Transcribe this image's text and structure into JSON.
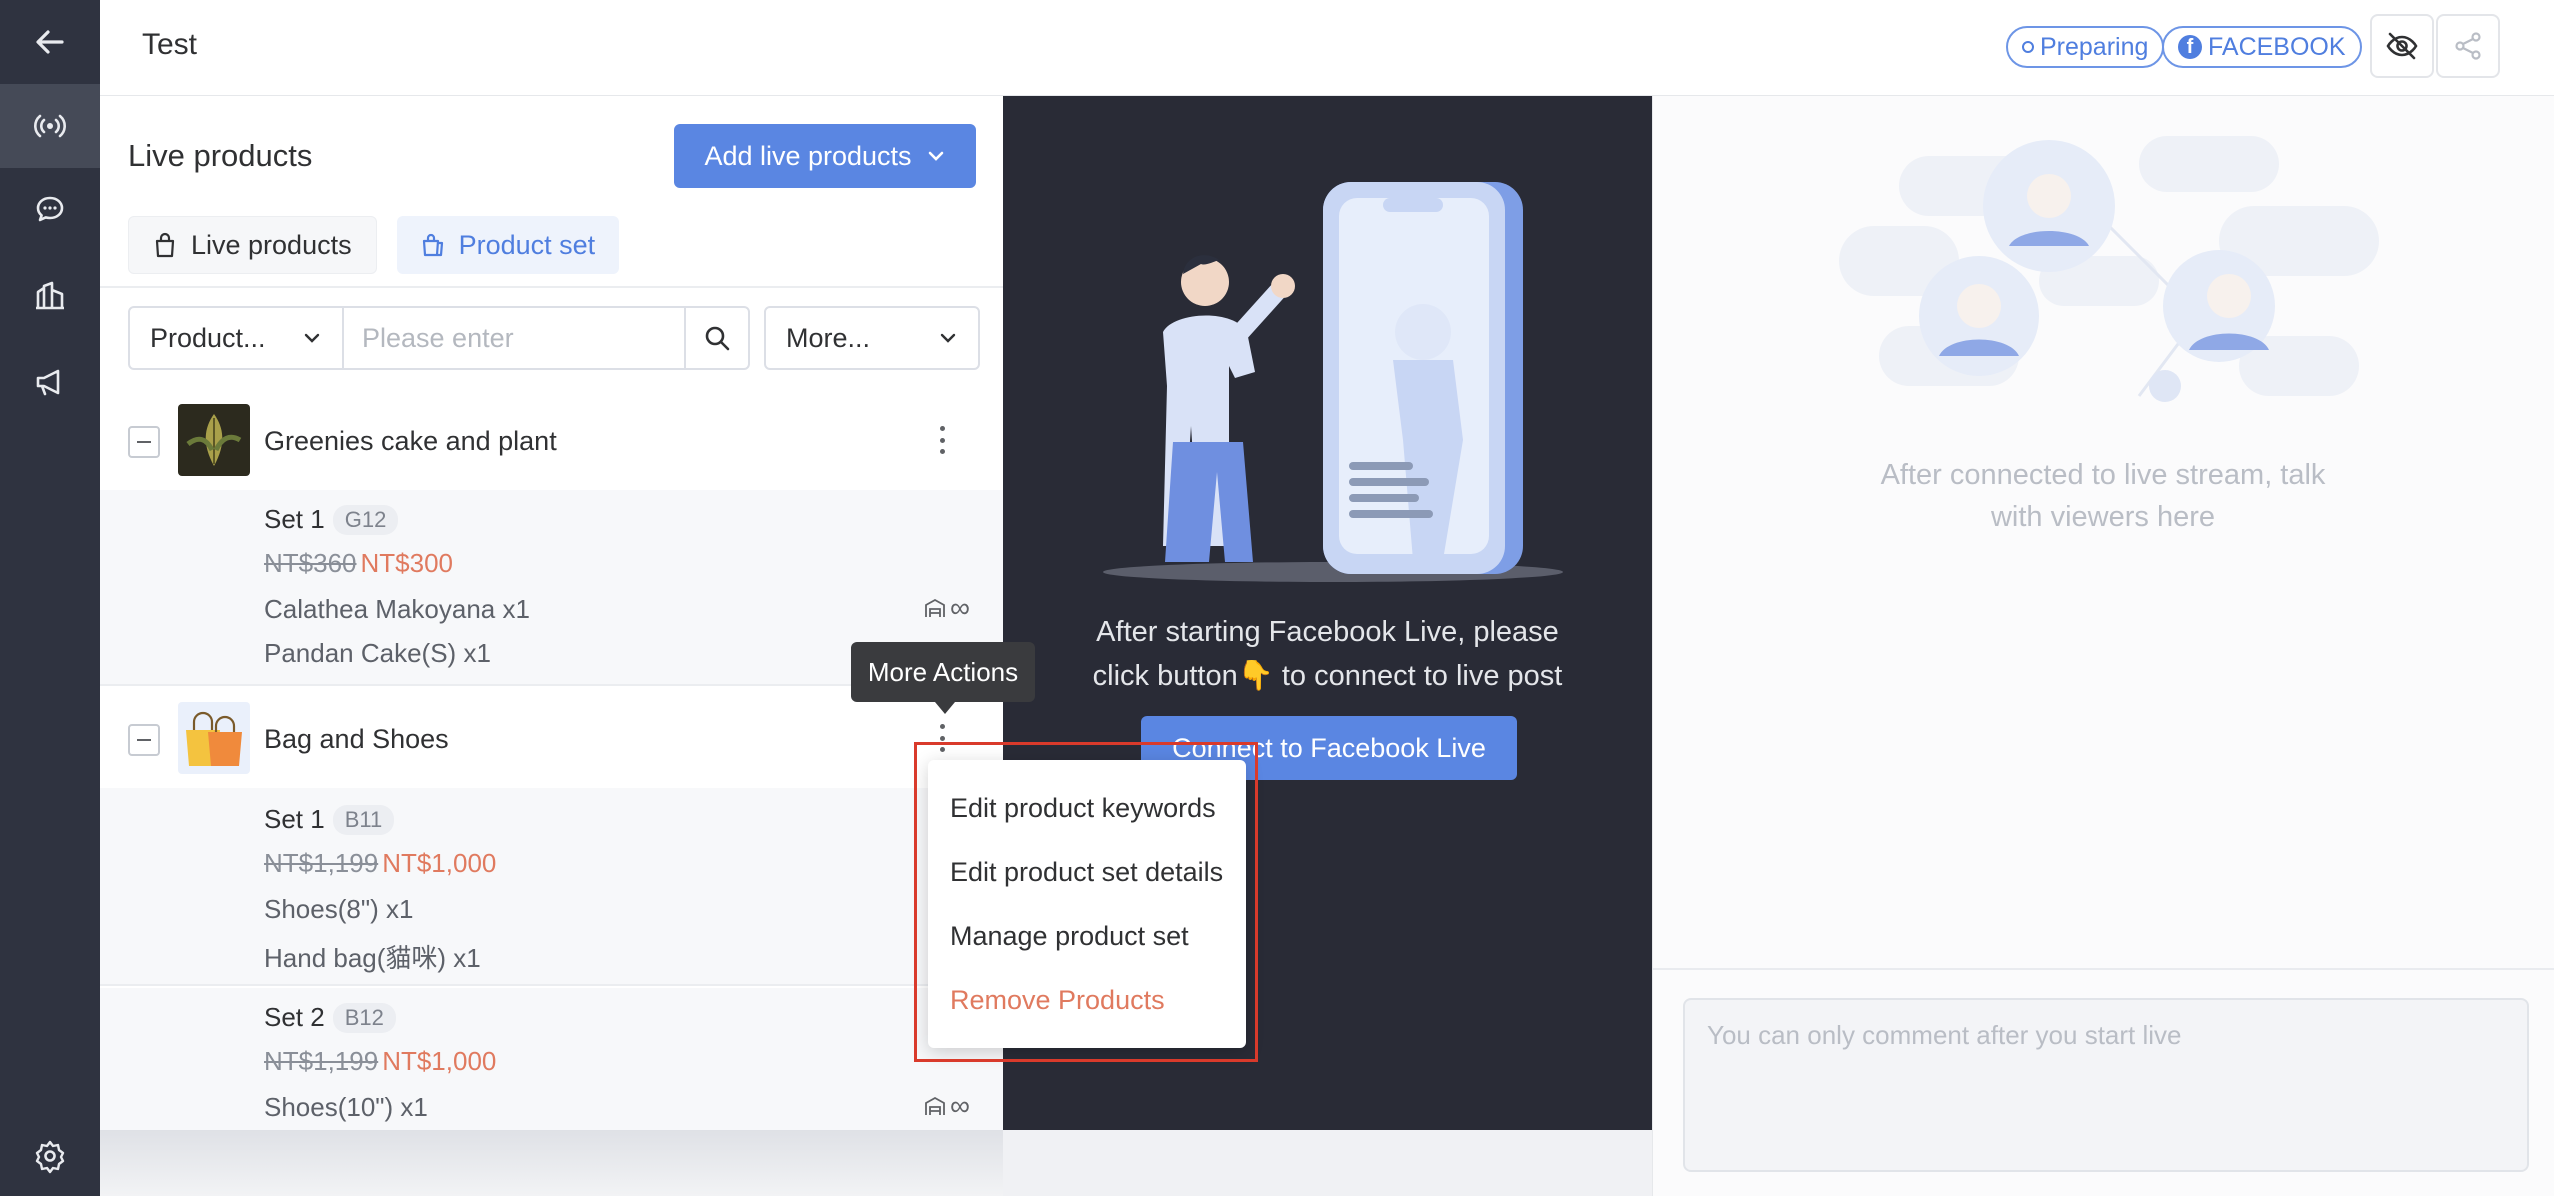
{
  "topbar": {
    "title": "Test",
    "status_badge": "Preparing",
    "platform_badge": "FACEBOOK"
  },
  "rail": {
    "icons": [
      "back-arrow-icon",
      "broadcast-icon",
      "chat-icon",
      "store-icon",
      "megaphone-icon",
      "settings-gear-icon"
    ],
    "active": "broadcast-icon"
  },
  "panel": {
    "title": "Live products",
    "add_button": "Add live products",
    "tabs": [
      {
        "label": "Live products",
        "active": true
      },
      {
        "label": "Product set",
        "active": false
      }
    ],
    "filters": {
      "type_select": "Product...",
      "search_placeholder": "Please enter",
      "more_select": "More..."
    },
    "groups": [
      {
        "name": "Greenies cake and plant",
        "sets": [
          {
            "label": "Set 1",
            "code": "G12",
            "price_old": "NT$360",
            "price_new": "NT$300",
            "items": [
              "Calathea Makoyana x1",
              "Pandan Cake(S) x1"
            ]
          }
        ]
      },
      {
        "name": "Bag and Shoes",
        "sets": [
          {
            "label": "Set 1",
            "code": "B11",
            "price_old": "NT$1,199",
            "price_new": "NT$1,000",
            "items": [
              "Shoes(8\") x1",
              "Hand bag(貓咪) x1"
            ]
          },
          {
            "label": "Set 2",
            "code": "B12",
            "price_old": "NT$1,199",
            "price_new": "NT$1,000",
            "items": [
              "Shoes(10\") x1"
            ]
          }
        ]
      }
    ],
    "stock_symbol": "∞"
  },
  "preview": {
    "line1": "After starting Facebook Live, please",
    "line2": "click button👇 to connect to live post",
    "connect_button": "Connect to Facebook Live"
  },
  "chat": {
    "hint_line1": "After connected to live stream, talk",
    "hint_line2": "with viewers here",
    "input_placeholder": "You can only comment after you start live"
  },
  "tooltip": "More Actions",
  "menu": {
    "items": [
      {
        "label": "Edit product keywords"
      },
      {
        "label": "Edit product set details"
      },
      {
        "label": "Manage product set"
      },
      {
        "label": "Remove Products",
        "danger": true
      }
    ]
  },
  "colors": {
    "accent": "#5a86e2",
    "rail": "#2f3340",
    "preview_bg": "#292b36",
    "sale_price": "#e07a5f",
    "highlight": "#d93a2b"
  }
}
